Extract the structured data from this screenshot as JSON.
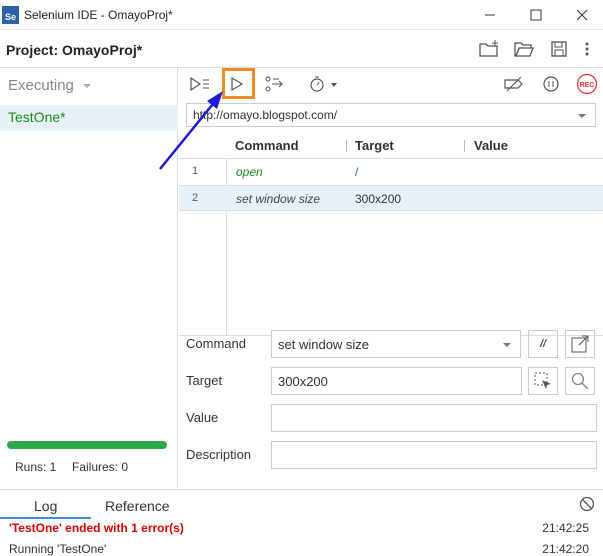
{
  "window": {
    "title": "Selenium IDE - OmayoProj*",
    "icon_text": "Se"
  },
  "project": {
    "label": "Project:",
    "name": "OmayoProj*"
  },
  "sidebar": {
    "mode": "Executing",
    "test": "TestOne*",
    "runs_label": "Runs: 1",
    "failures_label": "Failures: 0",
    "progress": 1.0
  },
  "url": {
    "value": "http://omayo.blogspot.com/"
  },
  "table": {
    "headers": [
      "Command",
      "Target",
      "Value"
    ],
    "rows": [
      {
        "num": "1",
        "command": "open",
        "target": "/",
        "value": ""
      },
      {
        "num": "2",
        "command": "set window size",
        "target": "300x200",
        "value": ""
      }
    ]
  },
  "editor": {
    "command_label": "Command",
    "command_value": "set window size",
    "target_label": "Target",
    "target_value": "300x200",
    "value_label": "Value",
    "value_value": "",
    "description_label": "Description",
    "description_value": "",
    "comment_button": "//"
  },
  "bottom": {
    "tabs": [
      "Log",
      "Reference"
    ],
    "log": [
      {
        "text": "'TestOne' ended with 1 error(s)",
        "time": "21:42:25"
      },
      {
        "text": "Running 'TestOne'",
        "time": "21:42:20"
      }
    ]
  },
  "toolbar": {
    "rec_label": "REC"
  },
  "colors": {
    "accent": "#3a8fd8",
    "highlight": "#f08a24",
    "success": "#2ea84a",
    "error": "#d00000",
    "selected_row": "#e8f1f8"
  }
}
